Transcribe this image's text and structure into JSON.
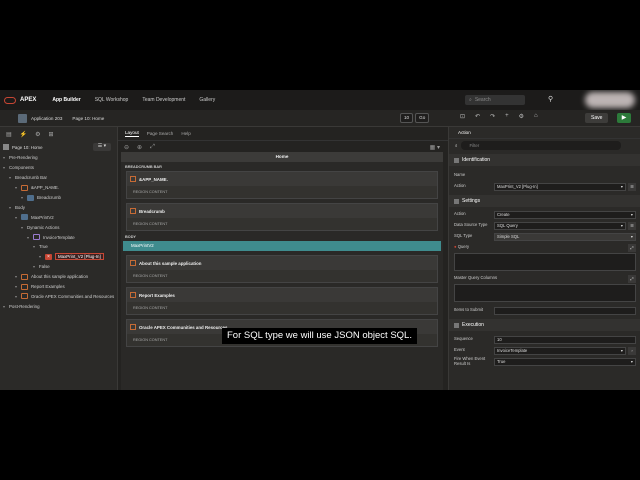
{
  "topbar": {
    "brand": "APEX",
    "nav": [
      "App Builder",
      "SQL Workshop",
      "Team Development",
      "Gallery"
    ],
    "search_placeholder": "Search"
  },
  "toolbar": {
    "app": "Application 203",
    "page": "Page 10: Home",
    "page_number": "10",
    "go_label": "Go",
    "save_label": "Save"
  },
  "left": {
    "page_title": "Page 10: Home",
    "tree": [
      {
        "label": "Pre-Rendering",
        "indent": 0,
        "icon": ""
      },
      {
        "label": "Components",
        "indent": 0,
        "icon": ""
      },
      {
        "label": "Breadcrumb Bar",
        "indent": 1,
        "icon": ""
      },
      {
        "label": "&APP_NAME.",
        "indent": 2,
        "icon": "region"
      },
      {
        "label": "Breadcrumb",
        "indent": 3,
        "icon": "bar"
      },
      {
        "label": "Body",
        "indent": 1,
        "icon": ""
      },
      {
        "label": "MaxPrintV2",
        "indent": 2,
        "icon": "bar"
      },
      {
        "label": "Dynamic Actions",
        "indent": 3,
        "icon": ""
      },
      {
        "label": "InvoiceTemplate",
        "indent": 4,
        "icon": "da"
      },
      {
        "label": "True",
        "indent": 5,
        "icon": ""
      },
      {
        "label": "MaxPrint_V2 [Plug-In]",
        "indent": 6,
        "icon": "x",
        "selected": true
      },
      {
        "label": "False",
        "indent": 5,
        "icon": ""
      },
      {
        "label": "About this sample application",
        "indent": 2,
        "icon": "region"
      },
      {
        "label": "Report Examples",
        "indent": 2,
        "icon": "region"
      },
      {
        "label": "Oracle APEX Communities and Resources",
        "indent": 2,
        "icon": "region"
      },
      {
        "label": "Post-Rendering",
        "indent": 0,
        "icon": ""
      }
    ]
  },
  "center": {
    "tabs": [
      "Layout",
      "Page Search",
      "Help"
    ],
    "home_label": "Home",
    "breadcrumb_bar_label": "BREADCRUMB BAR",
    "body_label": "BODY",
    "region_content": "REGION CONTENT",
    "regions_top": [
      "&APP_NAME.",
      "Breadcrumb"
    ],
    "selected_region": "MaxPrintV2",
    "regions_body": [
      "About this sample application",
      "Report Examples",
      "Oracle APEX Communities and Resources"
    ]
  },
  "right": {
    "tab": "Action",
    "filter_placeholder": "Filter",
    "identification": {
      "title": "Identification",
      "name_label": "Name",
      "action_label": "Action",
      "action_value": "MaxPrint_V2 [Plug-In]"
    },
    "settings": {
      "title": "Settings",
      "action_label": "Action",
      "action_value": "Create",
      "dst_label": "Data Source Type",
      "dst_value": "SQL Query",
      "sqltype_label": "SQL Type",
      "sqltype_value": "Simple SQL",
      "query_label": "Query",
      "master_label": "Master Query Columns",
      "items_label": "Items to Submit"
    },
    "execution": {
      "title": "Execution",
      "sequence_label": "Sequence",
      "sequence_value": "10",
      "event_label": "Event",
      "event_value": "InvoiceTemplate",
      "fire_label": "Fire When Event Result Is",
      "fire_value": "True"
    }
  },
  "caption": "For SQL type we will use JSON object SQL."
}
